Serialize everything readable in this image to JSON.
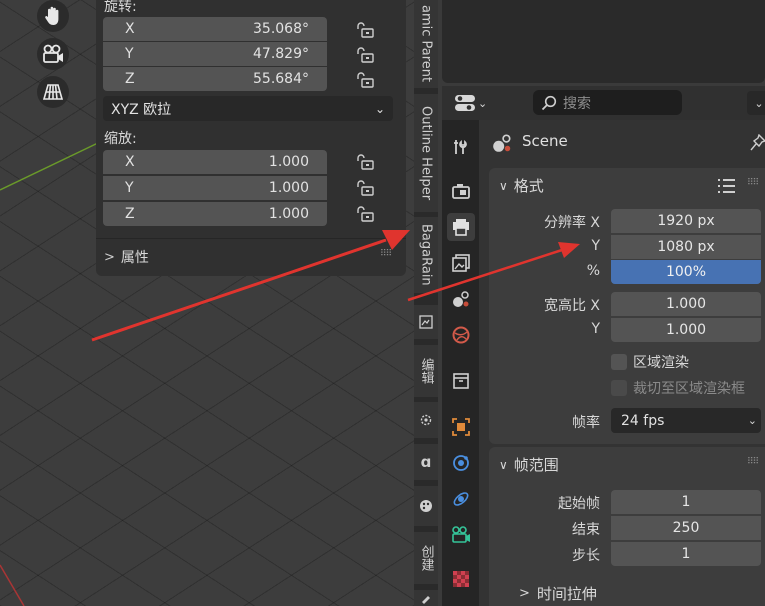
{
  "viewport": {
    "gizmo_buttons": [
      "hand-icon",
      "camera-icon",
      "grid-icon"
    ]
  },
  "npanel": {
    "rotation_label": "旋转:",
    "rotation": [
      {
        "axis": "X",
        "value": "35.068°"
      },
      {
        "axis": "Y",
        "value": "47.829°"
      },
      {
        "axis": "Z",
        "value": "55.684°"
      }
    ],
    "rotation_mode": "XYZ 欧拉",
    "scale_label": "缩放:",
    "scale": [
      {
        "axis": "X",
        "value": "1.000"
      },
      {
        "axis": "Y",
        "value": "1.000"
      },
      {
        "axis": "Z",
        "value": "1.000"
      }
    ],
    "properties_label": "属性"
  },
  "sidebar_tabs": [
    "amic Parent",
    "Outline Helper",
    "BagaRain",
    "编辑",
    "创建"
  ],
  "properties": {
    "search_placeholder": "搜索",
    "scene_label": "Scene",
    "format": {
      "title": "格式",
      "res_x_label": "分辨率 X",
      "res_x": "1920 px",
      "res_y_label": "Y",
      "res_y": "1080 px",
      "res_pct_label": "%",
      "res_pct": "100%",
      "res_pct_fraction": 1.0,
      "aspect_x_label": "宽高比 X",
      "aspect_x": "1.000",
      "aspect_y_label": "Y",
      "aspect_y": "1.000",
      "region_render": "区域渲染",
      "crop_region": "裁切至区域渲染框",
      "fps_label": "帧率",
      "fps": "24 fps"
    },
    "frame_range": {
      "title": "帧范围",
      "start_label": "起始帧",
      "start": "1",
      "end_label": "结束",
      "end": "250",
      "step_label": "步长",
      "step": "1",
      "time_stretch": "时间拉伸"
    }
  },
  "colors": {
    "accent": "#4772b3",
    "arrow": "#e0342e"
  }
}
